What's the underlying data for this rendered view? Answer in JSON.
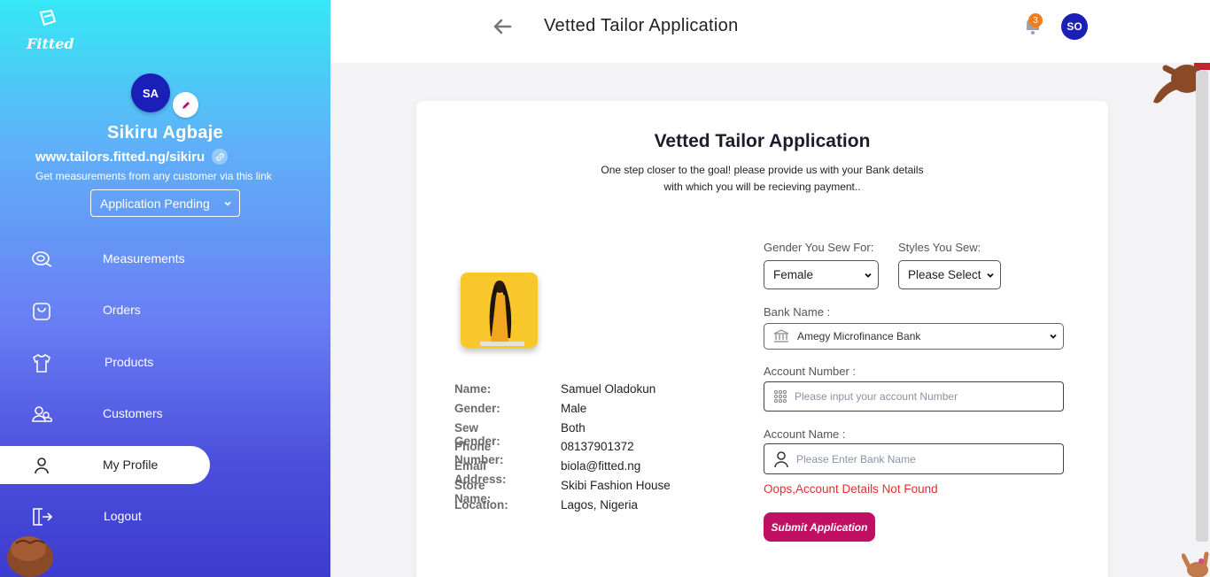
{
  "brand": {
    "logo_text": "Fitted"
  },
  "sidebar": {
    "avatar_initials": "SA",
    "user_name": "Sikiru Agbaje",
    "store_link": "www.tailors.fitted.ng/sikiru",
    "store_hint": "Get measurements from any customer via this link",
    "status_value": "Application Pending",
    "items": [
      {
        "label": "Measurements",
        "icon": "tape-measure-icon"
      },
      {
        "label": "Orders",
        "icon": "shopping-bag-icon"
      },
      {
        "label": "Products",
        "icon": "shirt-icon"
      },
      {
        "label": "Customers",
        "icon": "users-icon"
      },
      {
        "label": "My Profile",
        "icon": "user-icon",
        "active": true
      },
      {
        "label": "Logout",
        "icon": "logout-icon"
      }
    ]
  },
  "header": {
    "title": "Vetted Tailor Application",
    "notification_count": "3",
    "avatar_initials": "SO"
  },
  "card": {
    "title": "Vetted Tailor Application",
    "subtitle_line1": "One step closer to the goal! please provide us with your Bank details",
    "subtitle_line2": "with which you will be recieving payment.."
  },
  "profile": [
    {
      "key": "Name:",
      "value": "Samuel Oladokun"
    },
    {
      "key": "Gender:",
      "value": "Male"
    },
    {
      "key": "Sew Gender:",
      "value": "Both"
    },
    {
      "key": "Phone Number:",
      "value": "08137901372"
    },
    {
      "key": "Email Address:",
      "value": "biola@fitted.ng"
    },
    {
      "key": "Store Name:",
      "value": "Skibi Fashion House"
    },
    {
      "key": "Location:",
      "value": "Lagos, Nigeria"
    }
  ],
  "form": {
    "gender_label": "Gender You Sew For:",
    "gender_value": "Female",
    "styles_label": "Styles You Sew:",
    "styles_value": "Please Select",
    "bank_label": "Bank Name :",
    "bank_value": "Amegy Microfinance Bank",
    "account_number_label": "Account Number :",
    "account_number_placeholder": "Please input your account Number",
    "account_name_label": "Account Name :",
    "account_name_placeholder": "Please Enter Bank Name",
    "error": "Oops,Account Details Not Found",
    "submit_label": "Submit Application"
  },
  "colors": {
    "accent": "#c01063",
    "avatar": "#1a1fb8",
    "error": "#e0302e",
    "badge": "#f07d1e"
  }
}
